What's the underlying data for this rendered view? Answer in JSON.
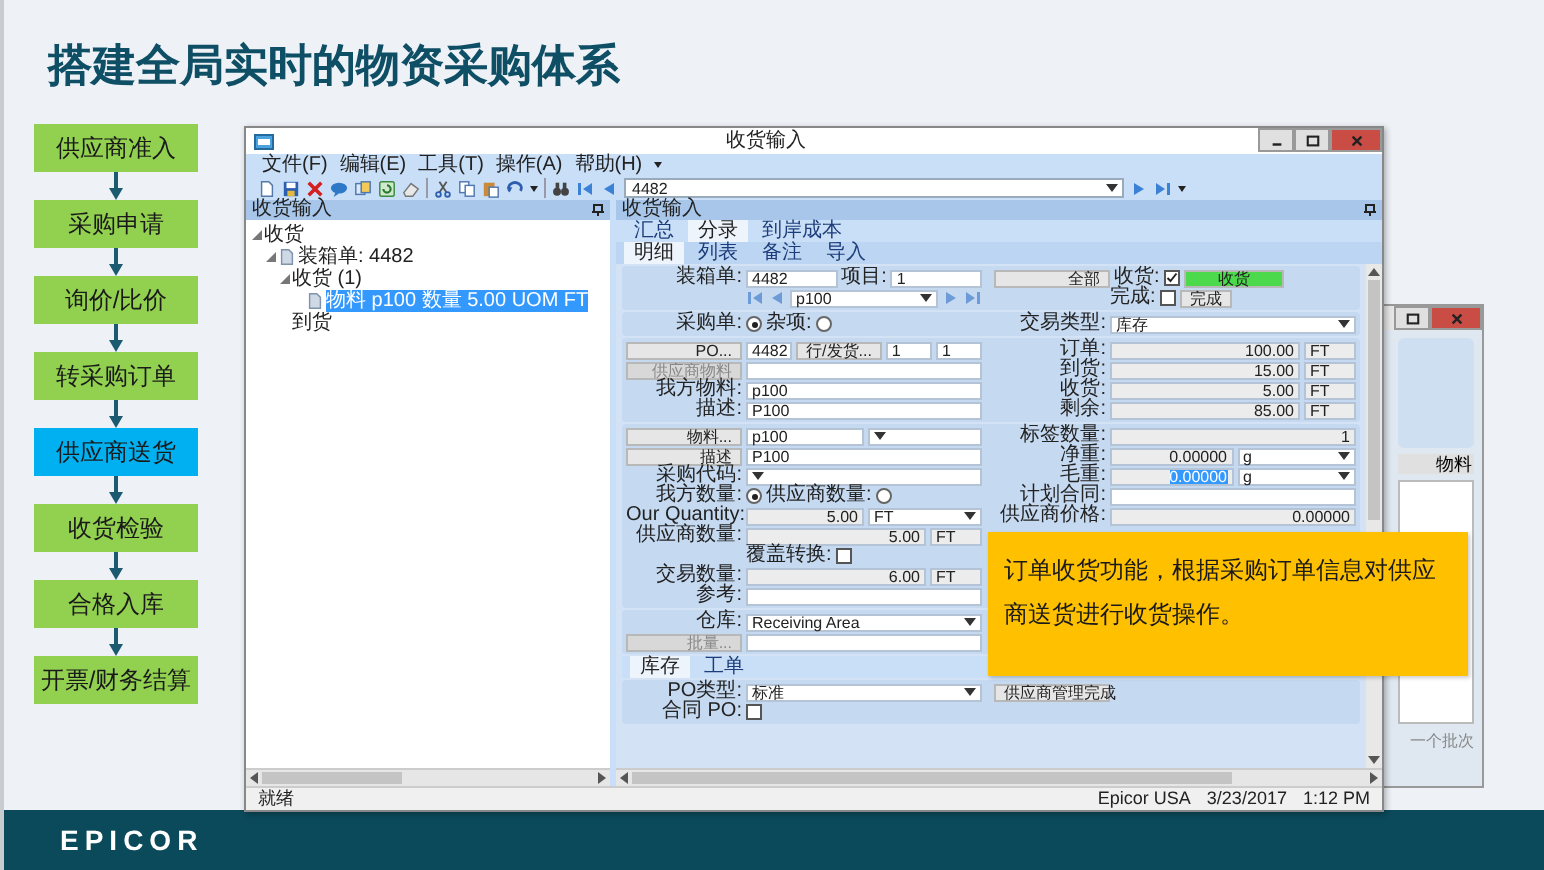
{
  "title": "搭建全局实时的物资采购体系",
  "flow": [
    {
      "label": "供应商准入",
      "selected": false
    },
    {
      "label": "采购申请",
      "selected": false
    },
    {
      "label": "询价/比价",
      "selected": false
    },
    {
      "label": "转采购订单",
      "selected": false
    },
    {
      "label": "供应商送货",
      "selected": true
    },
    {
      "label": "收货检验",
      "selected": false
    },
    {
      "label": "合格入库",
      "selected": false
    },
    {
      "label": "开票/财务结算",
      "selected": false
    }
  ],
  "back_window": {
    "column": "物料",
    "note": "一个批次"
  },
  "window": {
    "title": "收货输入",
    "menu": [
      "文件(F)",
      "编辑(E)",
      "工具(T)",
      "操作(A)",
      "帮助(H)"
    ],
    "toolbar_value": "4482",
    "tree_pane": {
      "title": "收货输入",
      "tree": [
        {
          "label": "收货",
          "selected": false,
          "children": [
            {
              "label": "装箱单: 4482",
              "kind": "document",
              "selected": false,
              "children": [
                {
                  "label": "收货 (1)",
                  "selected": false,
                  "children": [
                    {
                      "label": "物料 p100 数量 5.00 UOM FT",
                      "kind": "document",
                      "selected": true
                    }
                  ]
                },
                {
                  "label": "到货",
                  "selected": false
                }
              ]
            }
          ]
        }
      ]
    },
    "form_pane": {
      "title": "收货输入",
      "tabs": [
        {
          "label": "汇总",
          "selected": false
        },
        {
          "label": "分录",
          "selected": true
        },
        {
          "label": "到岸成本",
          "selected": false
        }
      ],
      "subtabs": [
        {
          "label": "明细",
          "selected": true
        },
        {
          "label": "列表",
          "selected": false
        },
        {
          "label": "备注",
          "selected": false
        },
        {
          "label": "导入",
          "selected": false
        }
      ],
      "form": [
        {
          "kind": "section",
          "rows": [
            {
              "left": [
                {
                  "kind": "label",
                  "text": "装箱单:"
                },
                {
                  "kind": "field",
                  "text": "4482"
                },
                {
                  "kind": "label",
                  "text": "项目:"
                },
                {
                  "kind": "field",
                  "text": "1"
                }
              ],
              "right": [
                {
                  "kind": "button",
                  "text": "全部",
                  "disabled": false
                },
                {
                  "kind": "label",
                  "text": "收货:"
                },
                {
                  "kind": "check",
                  "checked": true
                },
                {
                  "kind": "status",
                  "text": "收货"
                }
              ]
            },
            {
              "left": [
                {
                  "kind": "spacer"
                },
                {
                  "kind": "first"
                },
                {
                  "kind": "prev"
                },
                {
                  "kind": "select",
                  "text": "p100"
                },
                {
                  "kind": "next"
                },
                {
                  "kind": "last"
                }
              ],
              "right": [
                {
                  "kind": "spacer"
                },
                {
                  "kind": "label",
                  "text": "完成:"
                },
                {
                  "kind": "check",
                  "checked": false
                },
                {
                  "kind": "button",
                  "text": "完成",
                  "disabled": false
                }
              ]
            }
          ]
        },
        {
          "kind": "section",
          "rows": [
            {
              "left": [
                {
                  "kind": "label",
                  "text": "采购单:"
                },
                {
                  "kind": "radio",
                  "selected": true
                },
                {
                  "kind": "label",
                  "text": "杂项:"
                },
                {
                  "kind": "radio",
                  "selected": false
                }
              ],
              "right": [
                {
                  "kind": "label",
                  "text": "交易类型:"
                },
                {
                  "kind": "select",
                  "text": "库存"
                }
              ]
            }
          ]
        },
        {
          "kind": "section",
          "rows": [
            {
              "left": [
                {
                  "kind": "button",
                  "text": "PO...",
                  "disabled": false
                },
                {
                  "kind": "field",
                  "text": "4482"
                },
                {
                  "kind": "button",
                  "text": "行/发货...",
                  "disabled": false
                },
                {
                  "kind": "field",
                  "text": "1"
                },
                {
                  "kind": "field",
                  "text": "1"
                }
              ],
              "right": [
                {
                  "kind": "label",
                  "text": "订单:"
                },
                {
                  "kind": "number",
                  "text": "100.00"
                },
                {
                  "kind": "unit",
                  "text": "FT"
                }
              ]
            },
            {
              "left": [
                {
                  "kind": "button",
                  "text": "供应商物料",
                  "disabled": true
                },
                {
                  "kind": "field"
                }
              ],
              "right": [
                {
                  "kind": "label",
                  "text": "到货:"
                },
                {
                  "kind": "number",
                  "text": "15.00"
                },
                {
                  "kind": "unit",
                  "text": "FT"
                }
              ]
            },
            {
              "left": [
                {
                  "kind": "label",
                  "text": "我方物料:"
                },
                {
                  "kind": "field",
                  "text": "p100"
                }
              ],
              "right": [
                {
                  "kind": "label",
                  "text": "收货:"
                },
                {
                  "kind": "number",
                  "text": "5.00"
                },
                {
                  "kind": "unit",
                  "text": "FT"
                }
              ]
            },
            {
              "left": [
                {
                  "kind": "label",
                  "text": "描述:"
                },
                {
                  "kind": "field",
                  "text": "P100"
                }
              ],
              "right": [
                {
                  "kind": "label",
                  "text": "剩余:"
                },
                {
                  "kind": "number",
                  "text": "85.00"
                },
                {
                  "kind": "unit",
                  "text": "FT"
                }
              ]
            }
          ]
        },
        {
          "kind": "section",
          "rows": [
            {
              "left": [
                {
                  "kind": "button",
                  "text": "物料...",
                  "disabled": false
                },
                {
                  "kind": "field",
                  "text": "p100"
                },
                {
                  "kind": "select"
                }
              ],
              "right": [
                {
                  "kind": "label",
                  "text": "标签数量:"
                },
                {
                  "kind": "number",
                  "text": "1"
                }
              ]
            },
            {
              "left": [
                {
                  "kind": "button",
                  "text": "描述",
                  "disabled": false
                },
                {
                  "kind": "field",
                  "text": "P100"
                }
              ],
              "right": [
                {
                  "kind": "label",
                  "text": "净重:"
                },
                {
                  "kind": "number",
                  "text": "0.00000"
                },
                {
                  "kind": "select",
                  "text": "g"
                }
              ]
            },
            {
              "left": [
                {
                  "kind": "label",
                  "text": "采购代码:"
                },
                {
                  "kind": "select"
                }
              ],
              "right": [
                {
                  "kind": "label",
                  "text": "毛重:"
                },
                {
                  "kind": "number",
                  "text": "0.00000",
                  "text_selected": true
                },
                {
                  "kind": "select",
                  "text": "g"
                }
              ]
            },
            {
              "left": [
                {
                  "kind": "label",
                  "text": "我方数量:"
                },
                {
                  "kind": "radio",
                  "selected": true
                },
                {
                  "kind": "label",
                  "text": "供应商数量:"
                },
                {
                  "kind": "radio",
                  "selected": false
                }
              ],
              "right": [
                {
                  "kind": "label",
                  "text": "计划合同:"
                },
                {
                  "kind": "field"
                }
              ]
            },
            {
              "left": [
                {
                  "kind": "label",
                  "text": "Our Quantity:"
                },
                {
                  "kind": "number",
                  "text": "5.00"
                },
                {
                  "kind": "select",
                  "text": "FT"
                }
              ],
              "right": [
                {
                  "kind": "label",
                  "text": "供应商价格:"
                },
                {
                  "kind": "number",
                  "text": "0.00000"
                }
              ]
            },
            {
              "left": [
                {
                  "kind": "label",
                  "text": "供应商数量:"
                },
                {
                  "kind": "number",
                  "text": "5.00"
                },
                {
                  "kind": "unit",
                  "text": "FT"
                }
              ],
              "right": []
            },
            {
              "left": [
                {
                  "kind": "spacer"
                },
                {
                  "kind": "label",
                  "text": "覆盖转换:"
                },
                {
                  "kind": "check",
                  "checked": false
                }
              ],
              "right": []
            },
            {
              "left": [
                {
                  "kind": "label",
                  "text": "交易数量:"
                },
                {
                  "kind": "number",
                  "text": "6.00"
                },
                {
                  "kind": "unit",
                  "text": "FT"
                }
              ],
              "right": []
            },
            {
              "left": [
                {
                  "kind": "label",
                  "text": "参考:"
                },
                {
                  "kind": "field"
                }
              ],
              "right": []
            }
          ]
        },
        {
          "kind": "section",
          "rows": [
            {
              "left": [
                {
                  "kind": "label",
                  "text": "仓库:"
                },
                {
                  "kind": "select",
                  "text": "Receiving Area"
                }
              ],
              "right": []
            },
            {
              "left": [
                {
                  "kind": "button",
                  "text": "批量...",
                  "disabled": true
                },
                {
                  "kind": "field"
                }
              ],
              "right": []
            }
          ]
        },
        {
          "kind": "tabs",
          "tabs": [
            {
              "label": "库存",
              "selected": true
            },
            {
              "label": "工单",
              "selected": false
            }
          ]
        },
        {
          "kind": "section",
          "rows": [
            {
              "left": [
                {
                  "kind": "label",
                  "text": "PO类型:"
                },
                {
                  "kind": "select",
                  "text": "标准"
                }
              ],
              "right": [
                {
                  "kind": "button",
                  "text": "供应商管理完成",
                  "disabled": false
                }
              ]
            },
            {
              "left": [
                {
                  "kind": "label",
                  "text": "合同 PO:"
                },
                {
                  "kind": "check",
                  "checked": false
                }
              ],
              "right": []
            }
          ]
        }
      ]
    },
    "status_bar": {
      "text": "就绪",
      "company": "Epicor USA",
      "date": "3/23/2017",
      "time": "1:12 PM"
    }
  },
  "callout": "订单收货功能，根据采购订单信息对供应商送货进行收货操作。",
  "brand": "EPICOR"
}
